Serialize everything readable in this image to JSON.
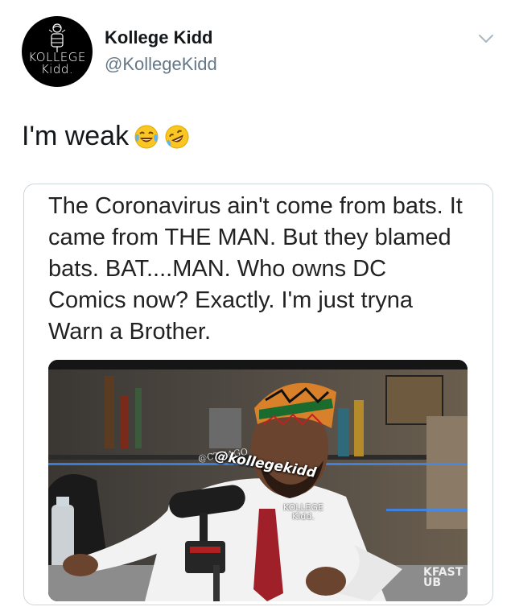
{
  "author": {
    "display_name": "Kollege Kidd",
    "handle": "@KollegeKidd",
    "avatar_text": [
      "KOLLEGE",
      "Kidd."
    ],
    "avatar_icon": "bee-mascot-icon"
  },
  "header": {
    "menu_icon": "chevron-down-icon"
  },
  "tweet": {
    "text": "I'm weak",
    "emojis": [
      "face-with-tears-of-joy-icon",
      "rolling-on-floor-laughing-icon"
    ]
  },
  "quoted_image": {
    "caption": "The Coronavirus ain't come from bats. It came from THE MAN. But they blamed bats. BAT....MAN. Who owns DC Comics now? Exactly. I'm just tryna Warn a Brother.",
    "watermark_handle": "@kollegekidd",
    "watermark_brand": [
      "KOLLEGE",
      "Kidd."
    ],
    "background_sign": "@CTHAGO",
    "studio_logo": [
      "KFAST",
      "UB"
    ]
  },
  "colors": {
    "text": "#14171a",
    "secondary": "#657786",
    "border": "#ccd6dd",
    "background": "#ffffff"
  }
}
